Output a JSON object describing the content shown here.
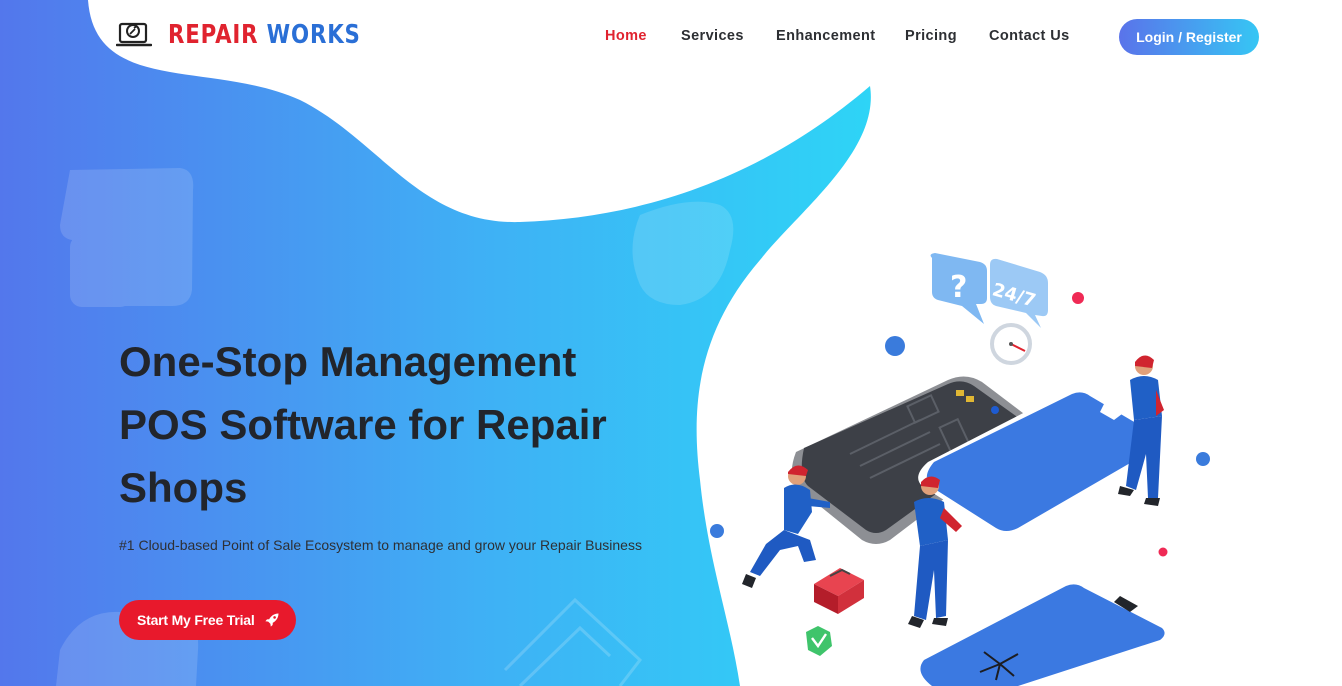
{
  "brand": {
    "word1": "REPAIR",
    "word2": "WORKS",
    "icon": "laptop-repair-icon"
  },
  "nav": {
    "items": [
      {
        "label": "Home",
        "active": true
      },
      {
        "label": "Services",
        "active": false
      },
      {
        "label": "Enhancement",
        "active": false
      },
      {
        "label": "Pricing",
        "active": false
      },
      {
        "label": "Contact Us",
        "active": false
      }
    ],
    "login_label": "Login / Register"
  },
  "hero": {
    "title": "One-Stop Management POS Software for Repair Shops",
    "subtitle": "#1 Cloud-based Point of Sale Ecosystem to manage and grow your Repair Business",
    "cta_label": "Start My Free Trial",
    "cta_icon": "rocket-icon"
  },
  "illustration": {
    "bubble_question": "?",
    "bubble_support": "24/7"
  },
  "colors": {
    "accent_red": "#e0232f",
    "cta_red": "#e8192c",
    "blue_start": "#5a73ea",
    "blue_end": "#36c6f4",
    "text_dark": "#22252b"
  }
}
